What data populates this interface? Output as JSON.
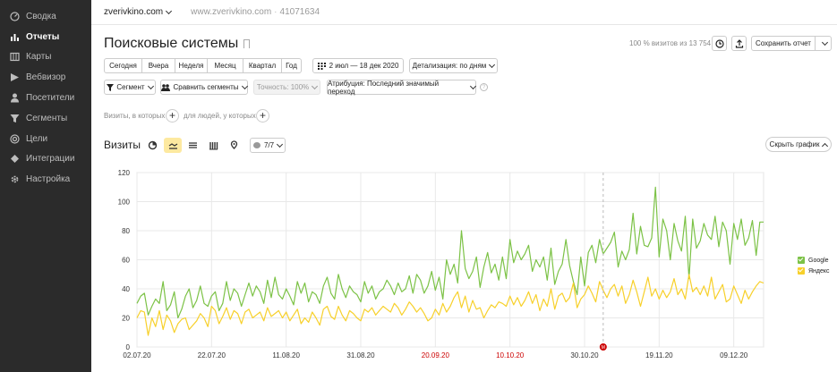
{
  "sidebar": {
    "items": [
      {
        "label": "Сводка",
        "icon": "dashboard-icon",
        "active": false
      },
      {
        "label": "Отчеты",
        "icon": "bar-chart-icon",
        "active": true
      },
      {
        "label": "Карты",
        "icon": "map-icon",
        "active": false
      },
      {
        "label": "Вебвизор",
        "icon": "play-icon",
        "active": false
      },
      {
        "label": "Посетители",
        "icon": "user-icon",
        "active": false
      },
      {
        "label": "Сегменты",
        "icon": "filter-icon",
        "active": false
      },
      {
        "label": "Цели",
        "icon": "target-icon",
        "active": false
      },
      {
        "label": "Интеграции",
        "icon": "integration-icon",
        "active": false
      },
      {
        "label": "Настройка",
        "icon": "gear-icon",
        "active": false
      }
    ]
  },
  "topbar": {
    "counter": "zverivkino.com",
    "site_url": "www.zverivkino.com",
    "separator": "·",
    "counter_id": "41071634"
  },
  "header": {
    "title": "Поисковые системы",
    "visits_share": "100 % визитов из 13 754",
    "save_label": "Сохранить отчет"
  },
  "period": {
    "buttons": [
      "Сегодня",
      "Вчера",
      "Неделя",
      "Месяц",
      "Квартал",
      "Год"
    ],
    "date_range": "2 июл — 18 дек 2020",
    "detail": "Детализация: по дням"
  },
  "segments": {
    "segment": "Сегмент",
    "compare": "Сравнить сегменты",
    "accuracy": "Точность: 100%",
    "attribution": "Атрибуция: Последний значимый переход",
    "help": "?"
  },
  "filters": {
    "visits_label": "Визиты, в которых",
    "people_label": "для людей, у которых",
    "plus": "+"
  },
  "chart_header": {
    "title": "Визиты",
    "series_count": "7/7",
    "hide_label": "Скрыть график"
  },
  "colors": {
    "google": "#7cc246",
    "yandex": "#f7d02a",
    "weekend_tick": "#cc0000",
    "sidebar_bg": "#2b2b2b",
    "active_chart_type": "#fde9a0"
  },
  "chart_data": {
    "type": "line",
    "ylim": [
      0,
      120
    ],
    "yticks": [
      0,
      20,
      40,
      60,
      80,
      100,
      120
    ],
    "xticks": [
      {
        "label": "02.07.20",
        "day": 0,
        "red": false
      },
      {
        "label": "22.07.20",
        "day": 20,
        "red": false
      },
      {
        "label": "11.08.20",
        "day": 40,
        "red": false
      },
      {
        "label": "31.08.20",
        "day": 60,
        "red": false
      },
      {
        "label": "20.09.20",
        "day": 80,
        "red": true
      },
      {
        "label": "10.10.20",
        "day": 100,
        "red": true
      },
      {
        "label": "30.10.20",
        "day": 120,
        "red": false
      },
      {
        "label": "19.11.20",
        "day": 140,
        "red": false
      },
      {
        "label": "09.12.20",
        "day": 160,
        "red": false
      }
    ],
    "grid": true,
    "legend_position": "right",
    "annotation": {
      "day": 125,
      "label": "M"
    },
    "series": [
      {
        "name": "Google",
        "values": [
          30,
          35,
          37,
          22,
          28,
          33,
          30,
          45,
          25,
          29,
          38,
          20,
          26,
          35,
          40,
          27,
          32,
          42,
          30,
          28,
          35,
          38,
          25,
          30,
          45,
          32,
          40,
          37,
          28,
          36,
          44,
          35,
          42,
          38,
          30,
          46,
          34,
          48,
          36,
          33,
          40,
          35,
          29,
          45,
          37,
          44,
          31,
          38,
          36,
          30,
          42,
          48,
          37,
          33,
          50,
          40,
          34,
          42,
          38,
          36,
          31,
          45,
          37,
          42,
          33,
          38,
          40,
          46,
          42,
          36,
          44,
          38,
          40,
          49,
          37,
          50,
          46,
          37,
          42,
          52,
          39,
          48,
          33,
          60,
          50,
          57,
          44,
          80,
          54,
          47,
          52,
          62,
          41,
          55,
          65,
          51,
          57,
          46,
          62,
          47,
          74,
          58,
          66,
          60,
          64,
          70,
          52,
          60,
          55,
          62,
          46,
          68,
          43,
          52,
          57,
          74,
          56,
          45,
          36,
          62,
          42,
          65,
          70,
          58,
          74,
          64,
          68,
          72,
          79,
          55,
          66,
          60,
          67,
          92,
          64,
          83,
          70,
          69,
          75,
          110,
          62,
          88,
          80,
          60,
          85,
          73,
          66,
          90,
          47,
          88,
          68,
          73,
          85,
          77,
          74,
          90,
          69,
          86,
          80,
          57,
          85,
          74,
          88,
          70,
          75,
          87,
          63,
          86,
          86
        ]
      },
      {
        "name": "Яндекс",
        "values": [
          20,
          25,
          24,
          8,
          20,
          14,
          25,
          12,
          22,
          18,
          10,
          16,
          19,
          20,
          12,
          15,
          18,
          23,
          20,
          14,
          28,
          25,
          16,
          21,
          27,
          19,
          25,
          23,
          16,
          24,
          26,
          20,
          22,
          24,
          18,
          27,
          21,
          23,
          25,
          20,
          24,
          18,
          22,
          26,
          16,
          20,
          17,
          24,
          20,
          15,
          26,
          28,
          21,
          19,
          28,
          22,
          18,
          25,
          23,
          20,
          18,
          26,
          24,
          27,
          22,
          25,
          28,
          26,
          24,
          30,
          27,
          22,
          26,
          31,
          28,
          24,
          27,
          23,
          18,
          20,
          26,
          22,
          30,
          24,
          28,
          34,
          38,
          27,
          35,
          24,
          32,
          26,
          27,
          20,
          25,
          29,
          27,
          31,
          30,
          28,
          35,
          29,
          34,
          28,
          32,
          38,
          30,
          36,
          25,
          33,
          28,
          40,
          26,
          35,
          37,
          31,
          34,
          44,
          27,
          33,
          36,
          42,
          37,
          31,
          45,
          39,
          34,
          40,
          43,
          35,
          42,
          30,
          36,
          46,
          38,
          28,
          38,
          48,
          35,
          40,
          33,
          39,
          34,
          38,
          47,
          36,
          40,
          33,
          50,
          38,
          41,
          36,
          42,
          35,
          48,
          33,
          38,
          43,
          31,
          33,
          42,
          36,
          30,
          39,
          33,
          38,
          42,
          45,
          44
        ]
      }
    ]
  }
}
